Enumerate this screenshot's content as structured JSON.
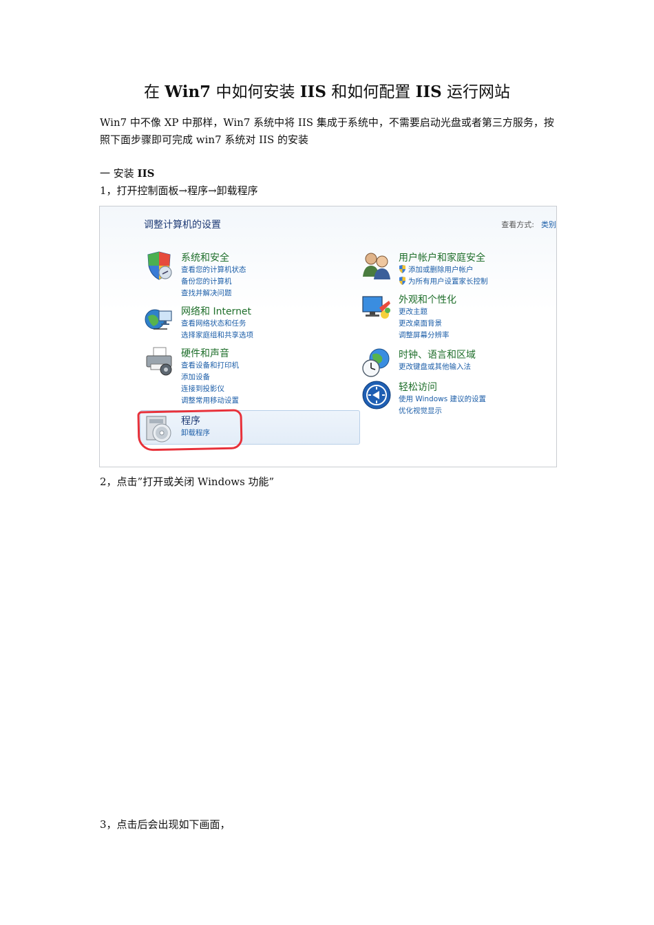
{
  "document": {
    "title_parts": [
      "在 ",
      "Win7",
      " 中如何安装 ",
      "IIS",
      " 和如何配置 ",
      "IIS",
      " 运行网站"
    ],
    "intro": "Win7 中不像 XP 中那样，Win7 系统中将 IIS 集成于系统中，不需要启动光盘或者第三方服务，按照下面步骤即可完成 win7 系统对 IIS 的安装",
    "section_prefix": "一  安装 ",
    "section_bold": "IIS",
    "step1": "1，打开控制面板→程序→卸载程序",
    "step2": "2，点击”打开或关闭 Windows 功能”",
    "step3": "3，点击后会出现如下画面，"
  },
  "control_panel": {
    "heading": "调整计算机的设置",
    "view_by_label": "查看方式:",
    "view_by_value": "类别",
    "categories": [
      {
        "title": "系统和安全",
        "icon": "shield-icon",
        "links": [
          "查看您的计算机状态",
          "备份您的计算机",
          "查找并解决问题"
        ]
      },
      {
        "title": "网络和 Internet",
        "icon": "network-globe-icon",
        "links": [
          "查看网络状态和任务",
          "选择家庭组和共享选项"
        ]
      },
      {
        "title": "硬件和声音",
        "icon": "printer-icon",
        "links": [
          "查看设备和打印机",
          "添加设备",
          "连接到投影仪",
          "调整常用移动设置"
        ]
      },
      {
        "title": "程序",
        "icon": "programs-disc-icon",
        "links": [
          "卸载程序"
        ]
      },
      {
        "title": "用户帐户和家庭安全",
        "icon": "users-icon",
        "links": [
          "添加或删除用户帐户",
          "为所有用户设置家长控制"
        ]
      },
      {
        "title": "外观和个性化",
        "icon": "monitor-paint-icon",
        "links": [
          "更改主题",
          "更改桌面背景",
          "调整屏幕分辨率"
        ]
      },
      {
        "title": "时钟、语言和区域",
        "icon": "clock-globe-icon",
        "links": [
          "更改键盘或其他输入法"
        ]
      },
      {
        "title": "轻松访问",
        "icon": "accessibility-icon",
        "links": [
          "使用 Windows 建议的设置",
          "优化视觉显示"
        ]
      }
    ],
    "colors": {
      "title_green": "#1e6e2a",
      "link_blue": "#1c5ea8",
      "heading_blue": "#1e3a75",
      "highlight_red": "#e8313a"
    }
  }
}
